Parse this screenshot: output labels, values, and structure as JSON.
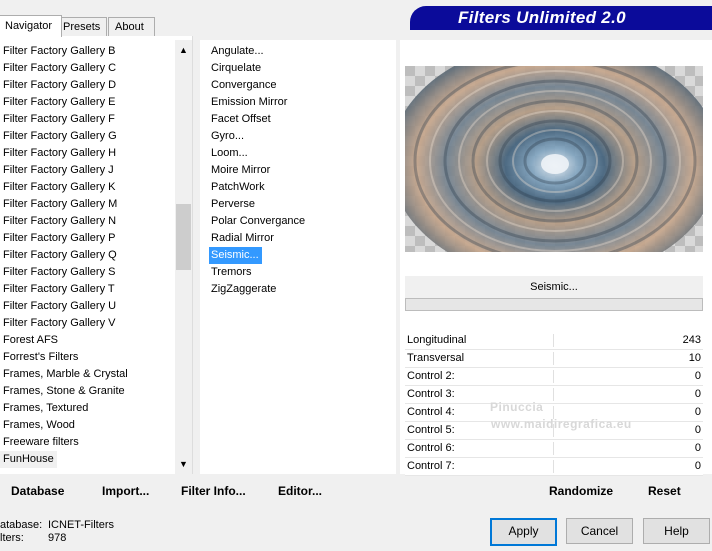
{
  "tabs": [
    {
      "label": "Navigator",
      "active": true
    },
    {
      "label": "Presets",
      "active": false
    },
    {
      "label": "About",
      "active": false
    }
  ],
  "header": {
    "title": "Filters Unlimited 2.0",
    "bg": "#0b0b9a"
  },
  "categories": [
    "Filter Factory Gallery B",
    "Filter Factory Gallery C",
    "Filter Factory Gallery D",
    "Filter Factory Gallery E",
    "Filter Factory Gallery F",
    "Filter Factory Gallery G",
    "Filter Factory Gallery H",
    "Filter Factory Gallery J",
    "Filter Factory Gallery K",
    "Filter Factory Gallery M",
    "Filter Factory Gallery N",
    "Filter Factory Gallery P",
    "Filter Factory Gallery Q",
    "Filter Factory Gallery S",
    "Filter Factory Gallery T",
    "Filter Factory Gallery U",
    "Filter Factory Gallery V",
    "Forest AFS",
    "Forrest's Filters",
    "Frames, Marble & Crystal",
    "Frames, Stone & Granite",
    "Frames, Textured",
    "Frames, Wood",
    "Freeware filters",
    "FunHouse"
  ],
  "selected_category": "FunHouse",
  "filters": [
    "Angulate...",
    "Cirquelate",
    "Convergance",
    "Emission Mirror",
    "Facet Offset",
    "Gyro...",
    "Loom...",
    "Moire Mirror",
    "PatchWork",
    "Perverse",
    "Polar Convergance",
    "Radial Mirror",
    "Seismic...",
    "Tremors",
    "ZigZaggerate"
  ],
  "selected_filter": "Seismic...",
  "filter_title": "Seismic...",
  "params": [
    {
      "label": "Longitudinal",
      "value": "243"
    },
    {
      "label": "Transversal",
      "value": "10"
    },
    {
      "label": "Control 2:",
      "value": "0"
    },
    {
      "label": "Control 3:",
      "value": "0"
    },
    {
      "label": "Control 4:",
      "value": "0"
    },
    {
      "label": "Control 5:",
      "value": "0"
    },
    {
      "label": "Control 6:",
      "value": "0"
    },
    {
      "label": "Control 7:",
      "value": "0"
    }
  ],
  "bottom_links": {
    "database": "Database",
    "import": "Import...",
    "filter_info": "Filter Info...",
    "editor": "Editor...",
    "randomize": "Randomize",
    "reset": "Reset"
  },
  "status": {
    "database_label": "atabase:",
    "database_value": "ICNET-Filters",
    "filters_label": "lters:",
    "filters_value": "978"
  },
  "buttons": {
    "apply": "Apply",
    "cancel": "Cancel",
    "help": "Help"
  },
  "watermark": {
    "name": "Pinuccia",
    "site": "www.maidiregrafica.eu"
  },
  "colors": {
    "selection": "#3399ff",
    "accent": "#0078d7"
  }
}
